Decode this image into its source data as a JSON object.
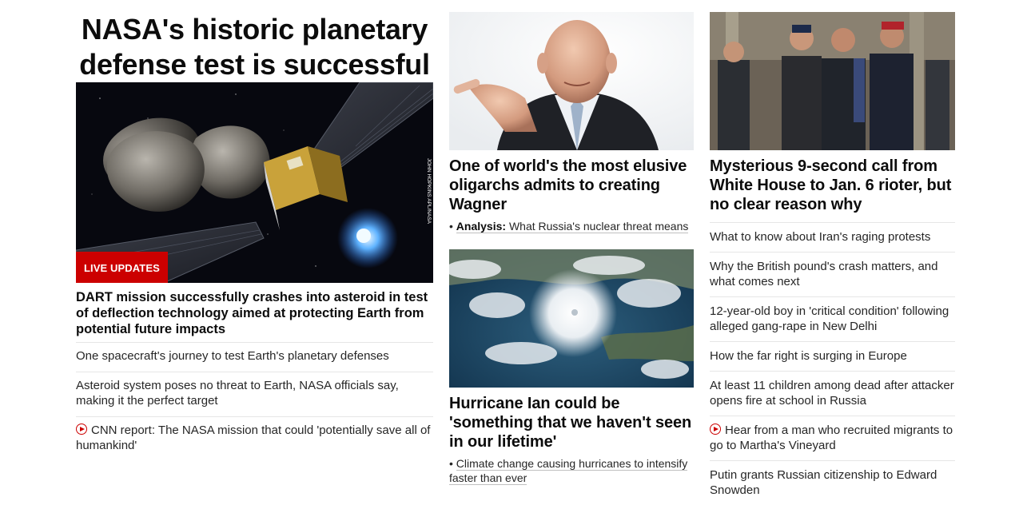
{
  "lead": {
    "headline": "NASA's historic planetary defense test is successful",
    "image_credit": "JOHN HOPKINS APL/NASA",
    "badge": "LIVE UPDATES",
    "summary": "DART mission successfully crashes into asteroid in test of deflection technology aimed at protecting Earth from potential future impacts",
    "links": [
      {
        "text": "One spacecraft's journey to test Earth's planetary defenses",
        "video": false
      },
      {
        "text": "Asteroid system poses no threat to Earth, NASA officials say, making it the perfect target",
        "video": false
      },
      {
        "text": "CNN report: The NASA mission that could 'potentially save all of humankind'",
        "video": true
      }
    ]
  },
  "middle": {
    "story1": {
      "headline": "One of world's the most elusive oligarchs admits to creating Wagner",
      "related_prefix": "Analysis:",
      "related_text": "What Russia's nuclear threat means"
    },
    "story2": {
      "headline": "Hurricane Ian could be 'something that we haven't seen in our lifetime'",
      "related_text": "Climate change causing hurricanes to intensify faster than ever"
    }
  },
  "right": {
    "headline": "Mysterious 9-second call from White House to Jan. 6 rioter, but no clear reason why",
    "links": [
      {
        "text": "What to know about Iran's raging protests",
        "video": false
      },
      {
        "text": "Why the British pound's crash matters, and what comes next",
        "video": false
      },
      {
        "text": "12-year-old boy in 'critical condition' following alleged gang-rape in New Delhi",
        "video": false
      },
      {
        "text": "How the far right is surging in Europe",
        "video": false
      },
      {
        "text": "At least 11 children among dead after attacker opens fire at school in Russia",
        "video": false
      },
      {
        "text": "Hear from a man who recruited migrants to go to Martha's Vineyard",
        "video": true
      },
      {
        "text": "Putin grants Russian citizenship to Edward Snowden",
        "video": false
      }
    ]
  },
  "colors": {
    "accent": "#cc0000",
    "text": "#0c0c0c",
    "divider": "#e6e6e6"
  }
}
